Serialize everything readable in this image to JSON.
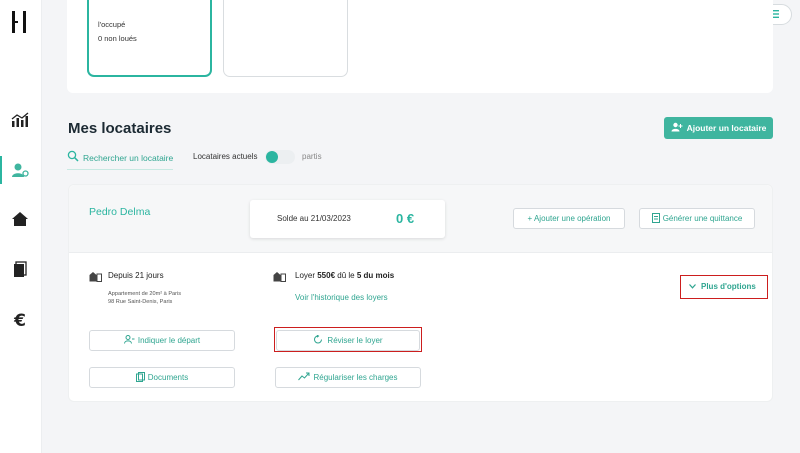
{
  "header": {
    "bell_icon": "bell-icon",
    "menu_icon": "hamburger-menu-icon"
  },
  "sidebar": {
    "logo": "H",
    "items": [
      {
        "icon": "chart-icon"
      },
      {
        "icon": "user-gear-icon",
        "active": true
      },
      {
        "icon": "home-icon"
      },
      {
        "icon": "documents-icon"
      },
      {
        "icon": "euro-icon",
        "glyph": "€"
      }
    ]
  },
  "property_cards": {
    "card1_line1": "l'occupé",
    "card1_line2": "0 non loués"
  },
  "tenants_section": {
    "title": "Mes locataires",
    "add_button": "Ajouter un locataire",
    "search_label": "Rechercher un locataire",
    "filter_current": "Locataires actuels",
    "filter_past": "partis"
  },
  "tenant": {
    "name": "Pedro Delma",
    "balance_label": "Solde au 21/03/2023",
    "balance_value": "0 €",
    "add_operation": "+ Ajouter une opération",
    "generate_receipt": "Générer une quittance",
    "since": "Depuis 21 jours",
    "apartment": "Appartement de 20m² à Paris",
    "address": "98 Rue Saint-Denis, Paris",
    "rent_prefix": "Loyer ",
    "rent_amount": "550€",
    "rent_mid": " dû le ",
    "rent_due": "5 du mois",
    "rent_history": "Voir l'historique des loyers",
    "more_options": "Plus d'options",
    "departure": "Indiquer le départ",
    "revise_rent": "Réviser le loyer",
    "documents": "Documents",
    "charges": "Régulariser les charges"
  },
  "colors": {
    "accent": "#2bb5a0",
    "highlight": "#cc1e1e"
  }
}
